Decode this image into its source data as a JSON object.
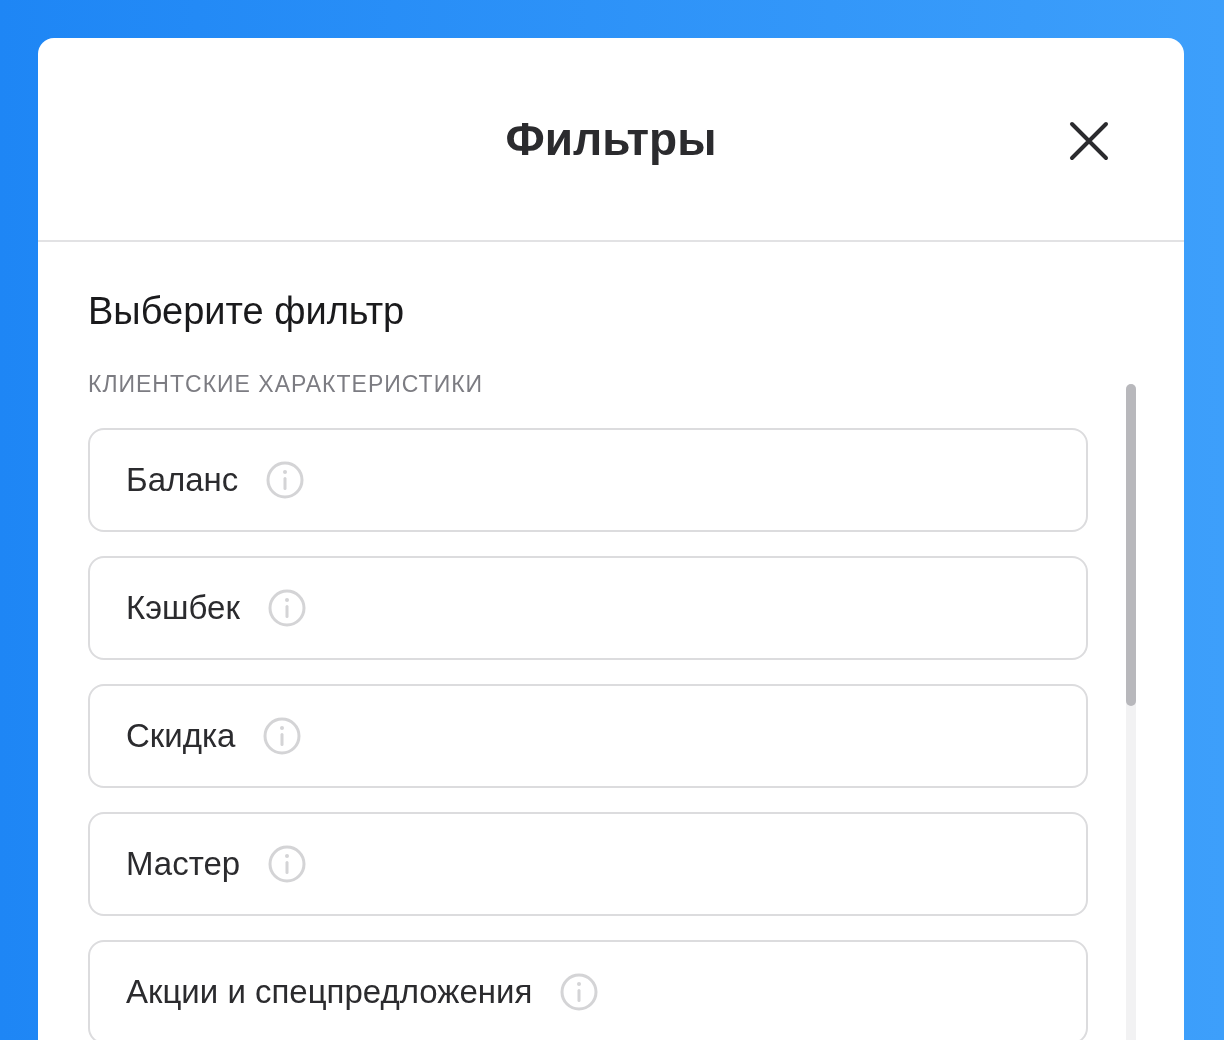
{
  "dialog": {
    "title": "Фильтры"
  },
  "body": {
    "heading": "Выберите фильтр",
    "section_label": "КЛИЕНТСКИЕ ХАРАКТЕРИСТИКИ",
    "filters": [
      {
        "label": "Баланс"
      },
      {
        "label": "Кэшбек"
      },
      {
        "label": "Скидка"
      },
      {
        "label": "Мастер"
      },
      {
        "label": "Акции и спецпредложения"
      }
    ]
  }
}
